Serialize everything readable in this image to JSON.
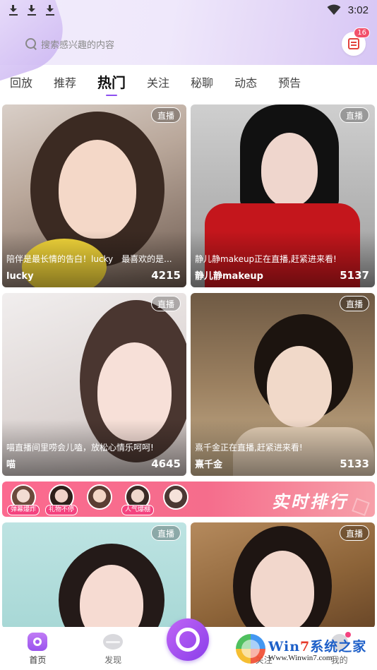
{
  "status_bar": {
    "time": "3:02",
    "download_icons": [
      "download-icon",
      "download-icon",
      "download-icon"
    ],
    "wifi": "wifi-icon"
  },
  "search": {
    "placeholder": "搜索感兴趣的内容",
    "message_badge": "16"
  },
  "tabs": [
    {
      "label": "回放",
      "active": false
    },
    {
      "label": "推荐",
      "active": false
    },
    {
      "label": "热门",
      "active": true
    },
    {
      "label": "关注",
      "active": false
    },
    {
      "label": "秘聊",
      "active": false
    },
    {
      "label": "动态",
      "active": false
    },
    {
      "label": "预告",
      "active": false
    }
  ],
  "cards": [
    {
      "badge": "直播",
      "desc": "陪伴是最长情的告白！lucky　最喜欢的是...",
      "name": "lucky",
      "count": "4215"
    },
    {
      "badge": "直播",
      "desc": "静儿静makeup正在直播,赶紧进来看!",
      "name": "静儿静makeup",
      "count": "5137"
    },
    {
      "badge": "直播",
      "desc": "喵直播间里唠会儿嗑，放松心情乐呵呵!",
      "name": "喵",
      "count": "4645"
    },
    {
      "badge": "直播",
      "desc": "熹千金正在直播,赶紧进来看!",
      "name": "熹千金",
      "count": "5133"
    },
    {
      "badge": "直播",
      "desc": "",
      "name": "",
      "count": ""
    },
    {
      "badge": "直播",
      "desc": "",
      "name": "",
      "count": ""
    }
  ],
  "rank_banner": {
    "title": "实时排行",
    "tags": [
      "弹幕爆炸",
      "礼物不停",
      "",
      "人气爆棚",
      ""
    ]
  },
  "bottom_nav": {
    "items": [
      {
        "label": "首页",
        "icon": "home-icon"
      },
      {
        "label": "发现",
        "icon": "discover-icon"
      },
      {
        "label": "",
        "icon": "live-icon"
      },
      {
        "label": "关注",
        "icon": "follow-icon"
      },
      {
        "label": "我的",
        "icon": "profile-icon"
      }
    ]
  },
  "watermark": {
    "brand_prefix": "Win",
    "brand_seven": "7",
    "brand_suffix": "系统之家",
    "url": "Www.Winwin7.com"
  },
  "colors": {
    "accent": "#8c4ef0",
    "badge": "#f2506b",
    "rank_banner": "#fb6a8f"
  }
}
